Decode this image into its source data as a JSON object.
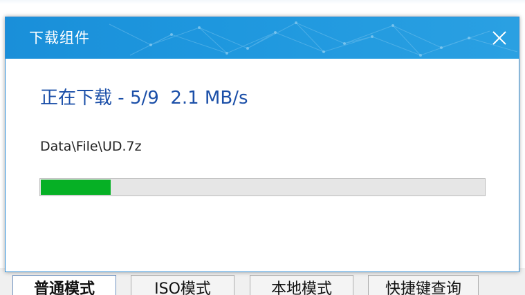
{
  "dialog": {
    "title": "下载组件",
    "close_icon": "close-icon",
    "status": {
      "label": "正在下载",
      "separator": "-",
      "progress_count": "5/9",
      "speed": "2.1 MB/s"
    },
    "current_file": "Data\\File\\UD.7z",
    "progress_fraction": 0.158,
    "colors": {
      "titlebar": "#1e97de",
      "status_text": "#1b4fa8",
      "progress_fill": "#06b025",
      "progress_track": "#e6e6e6"
    }
  },
  "background_tabs": [
    {
      "label": "普通模式",
      "active": true
    },
    {
      "label": "ISO模式",
      "active": false
    },
    {
      "label": "本地模式",
      "active": false
    },
    {
      "label": "快捷键查询",
      "active": false
    }
  ]
}
